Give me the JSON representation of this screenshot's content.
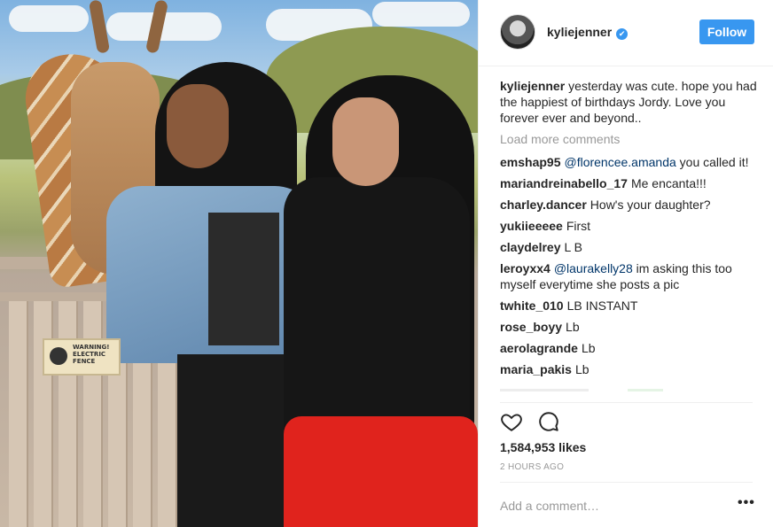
{
  "header": {
    "username": "kyliejenner",
    "verified_icon": "✔",
    "follow_label": "Follow"
  },
  "caption": {
    "author": "kyliejenner",
    "text": "yesterday was cute. hope you had the happiest of birthdays Jordy. Love you forever ever and beyond.."
  },
  "load_more": "Load more comments",
  "comments": [
    {
      "author": "emshap95",
      "mention": "@florencee.amanda",
      "text": "you called it!"
    },
    {
      "author": "mariandreinabello_17",
      "mention": "",
      "text": "Me encanta!!!"
    },
    {
      "author": "charley.dancer",
      "mention": "",
      "text": "How's your daughter?"
    },
    {
      "author": "yukiieeeee",
      "mention": "",
      "text": "First"
    },
    {
      "author": "claydelrey",
      "mention": "",
      "text": "L B"
    },
    {
      "author": "leroyxx4",
      "mention": "@laurakelly28",
      "text": "im asking this too myself everytime she posts a pic"
    },
    {
      "author": "twhite_010",
      "mention": "",
      "text": "LB INSTANT"
    },
    {
      "author": "rose_boyy",
      "mention": "",
      "text": "Lb"
    },
    {
      "author": "aerolagrande",
      "mention": "",
      "text": "Lb"
    },
    {
      "author": "maria_pakis",
      "mention": "",
      "text": "Lb"
    }
  ],
  "actions": {
    "like_icon": "heart-icon",
    "comment_icon": "comment-icon"
  },
  "likes": "1,584,953 likes",
  "timestamp": "2 HOURS AGO",
  "add_comment": {
    "placeholder": "Add a comment…"
  },
  "more_label": "•••",
  "photo": {
    "sign_title": "WARNING!",
    "sign_subtitle": "ELECTRIC FENCE"
  },
  "colors": {
    "accent": "#3897f0",
    "mention": "#003569",
    "muted": "#999999"
  }
}
